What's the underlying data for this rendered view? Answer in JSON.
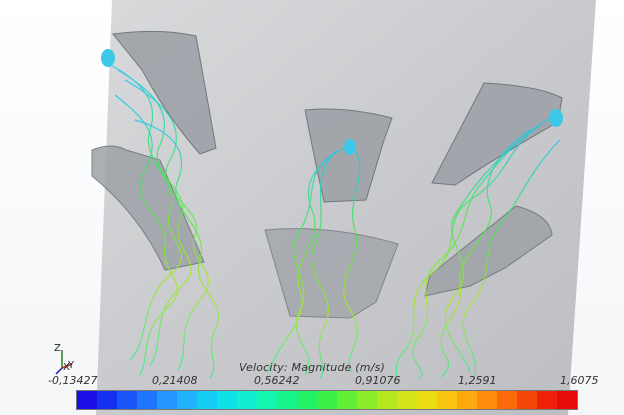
{
  "legend": {
    "title": "Velocity: Magnitude (m/s)",
    "ticks": [
      "-0,13427",
      "0,21408",
      "0,56242",
      "0,91076",
      "1,2591",
      "1,6075"
    ],
    "min": -0.13427,
    "max": 1.6075,
    "colors": [
      "#1a10e6",
      "#1431f0",
      "#1a55f7",
      "#1f75fb",
      "#2496fd",
      "#20b2fb",
      "#14cdf5",
      "#10e0e8",
      "#12eed2",
      "#14f5b0",
      "#18f58a",
      "#22f266",
      "#3cf046",
      "#62ee34",
      "#8cec28",
      "#b4e81e",
      "#d4e41a",
      "#ecdc14",
      "#f8c410",
      "#fca80e",
      "#fd8c0c",
      "#fb6a0a",
      "#f54608",
      "#ee2208",
      "#e60a08"
    ]
  },
  "triad": {
    "x": "X",
    "y": "Y",
    "z": "Z"
  }
}
